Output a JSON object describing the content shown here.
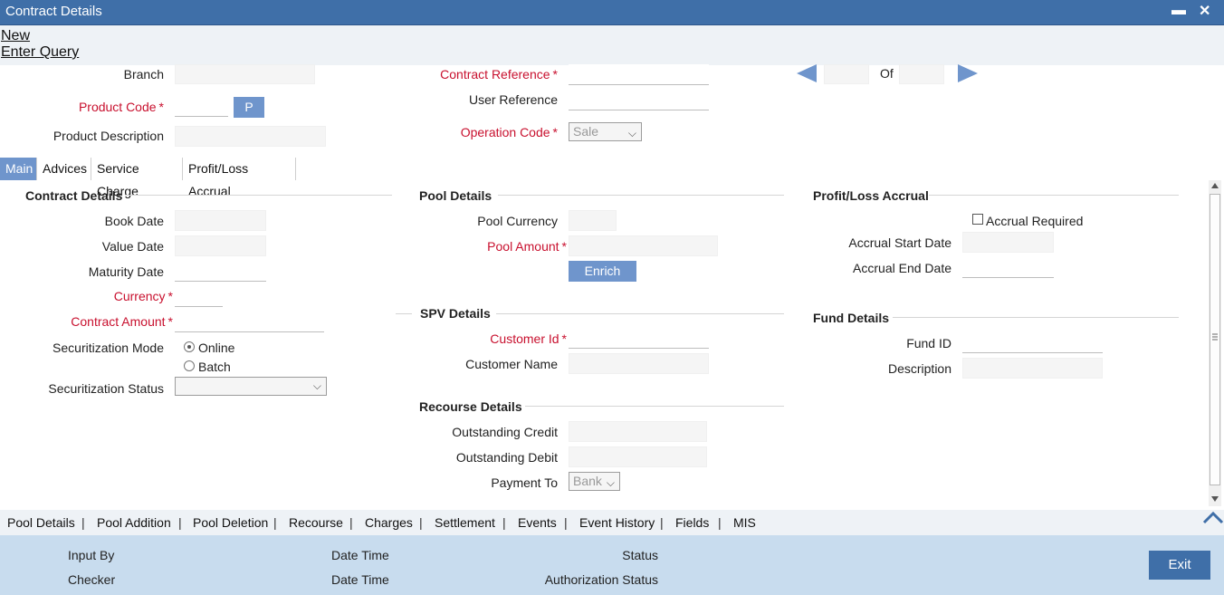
{
  "window": {
    "title": "Contract Details",
    "minimize": "▬",
    "close": "✕"
  },
  "menu": {
    "new": "New",
    "enter_query": "Enter Query"
  },
  "header": {
    "branch_label": "Branch",
    "product_code_label": "Product Code",
    "product_button": "P",
    "product_desc_label": "Product Description",
    "contract_ref_label": "Contract Reference",
    "user_ref_label": "User Reference",
    "operation_code_label": "Operation Code",
    "operation_code_value": "Sale",
    "of_label": "Of"
  },
  "tabs": [
    {
      "label": "Main"
    },
    {
      "label": "Advices"
    },
    {
      "label": "Service Charge"
    },
    {
      "label": "Profit/Loss Accrual"
    }
  ],
  "contract_details": {
    "title": "Contract Details",
    "book_date": "Book Date",
    "value_date": "Value Date",
    "maturity_date": "Maturity Date",
    "currency": "Currency",
    "contract_amount": "Contract Amount",
    "securitization_mode": "Securitization Mode",
    "online": "Online",
    "batch": "Batch",
    "securitization_status": "Securitization Status"
  },
  "pool_details": {
    "title": "Pool Details",
    "pool_currency": "Pool Currency",
    "pool_amount": "Pool Amount",
    "enrich": "Enrich"
  },
  "spv_details": {
    "title": "SPV Details",
    "customer_id": "Customer Id",
    "customer_name": "Customer Name"
  },
  "recourse_details": {
    "title": "Recourse Details",
    "outstanding_credit": "Outstanding Credit",
    "outstanding_debit": "Outstanding Debit",
    "payment_to": "Payment To",
    "payment_to_value": "Bank"
  },
  "pl_accrual": {
    "title": "Profit/Loss Accrual",
    "accrual_required": "Accrual Required",
    "accrual_start": "Accrual Start Date",
    "accrual_end": "Accrual End Date"
  },
  "fund_details": {
    "title": "Fund Details",
    "fund_id": "Fund ID",
    "description": "Description"
  },
  "bottom_nav": [
    {
      "label": "Pool Details"
    },
    {
      "label": "Pool Addition"
    },
    {
      "label": "Pool Deletion"
    },
    {
      "label": "Recourse"
    },
    {
      "label": "Charges"
    },
    {
      "label": "Settlement"
    },
    {
      "label": "Events"
    },
    {
      "label": "Event History"
    },
    {
      "label": "Fields"
    },
    {
      "label": "MIS"
    }
  ],
  "footer": {
    "input_by": "Input By",
    "checker": "Checker",
    "date_time_1": "Date Time",
    "date_time_2": "Date Time",
    "status": "Status",
    "auth_status": "Authorization Status",
    "exit": "Exit"
  },
  "required_marker": "*",
  "separator": "|",
  "colors": {
    "accent": "#3f6fa8",
    "button": "#6f95cc",
    "required": "#c8102e",
    "footer": "#c8dcee"
  }
}
